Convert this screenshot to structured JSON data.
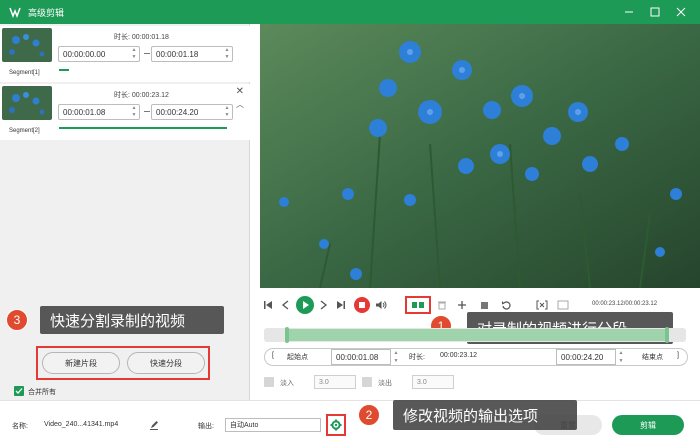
{
  "window": {
    "title": "高级剪辑"
  },
  "segments": [
    {
      "label": "Segment[1]",
      "duration_label": "时长:",
      "duration": "00:00:01.18",
      "start": "00:00:00.00",
      "end": "00:00:01.18"
    },
    {
      "label": "Segment[2]",
      "duration_label": "时长:",
      "duration": "00:00:23.12",
      "start": "00:00:01.08",
      "end": "00:00:24.20"
    }
  ],
  "left_actions": {
    "new_clip": "新建片段",
    "quick_split": "快速分段",
    "merge_all": "合并所有"
  },
  "callouts": [
    {
      "num": "3",
      "text": "快速分割录制的视频"
    },
    {
      "num": "1",
      "text": "对录制的视频进行分段"
    },
    {
      "num": "2",
      "text": "修改视频的输出选项"
    }
  ],
  "player": {
    "time_display": "00:00:23.12/00:00:23.12"
  },
  "trim": {
    "start_label": "起始点",
    "start_value": "00:00:01.08",
    "duration_label": "时长:",
    "duration_value": "00:00:23.12",
    "end_value": "00:00:24.20",
    "end_label": "结束点"
  },
  "fade": {
    "in_label": "淡入",
    "in_value": "3.0",
    "out_label": "淡出",
    "out_value": "3.0"
  },
  "bottom": {
    "name_label": "名称:",
    "file_name": "Video_240...41341.mp4",
    "output_label": "输出:",
    "output_value": "自动Auto",
    "reset_button": "重置",
    "cut_button": "剪辑"
  },
  "colors": {
    "brand_green": "#1e9a57",
    "callout_badge": "#e04a2e",
    "highlight_red": "#e53935",
    "record_red": "#e53935",
    "callout_bg": "#464646"
  },
  "icons": [
    "app-logo-icon",
    "minimize-icon",
    "maximize-icon",
    "close-icon",
    "prev-frame-icon",
    "play-icon",
    "next-frame-icon",
    "stop-icon",
    "volume-icon",
    "split-icon",
    "delete-icon",
    "add-icon",
    "copy-icon",
    "undo-icon",
    "mark-in-icon",
    "mark-out-icon",
    "edit-icon",
    "settings-gear-icon",
    "check-icon"
  ]
}
